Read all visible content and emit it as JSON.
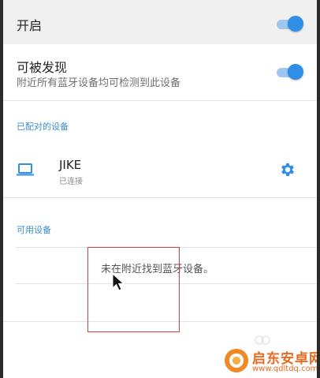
{
  "settings": {
    "enable": {
      "label": "开启",
      "on": true
    },
    "discoverable": {
      "label": "可被发现",
      "description": "附近所有蓝牙设备均可检测到此设备",
      "on": true
    }
  },
  "paired_section": {
    "header": "已配对的设备",
    "devices": [
      {
        "name": "JIKE",
        "status": "已连接",
        "icon": "laptop-icon"
      }
    ]
  },
  "available_section": {
    "header": "可用设备",
    "empty_message": "未在附近找到蓝牙设备。"
  },
  "watermark": {
    "name": "启东安卓网",
    "url": "www.qdltdq.com"
  },
  "colors": {
    "accent": "#2f8ee6",
    "section_header": "#3b8bd9",
    "annotation_box": "#e53935",
    "watermark": "#e86a1f"
  }
}
